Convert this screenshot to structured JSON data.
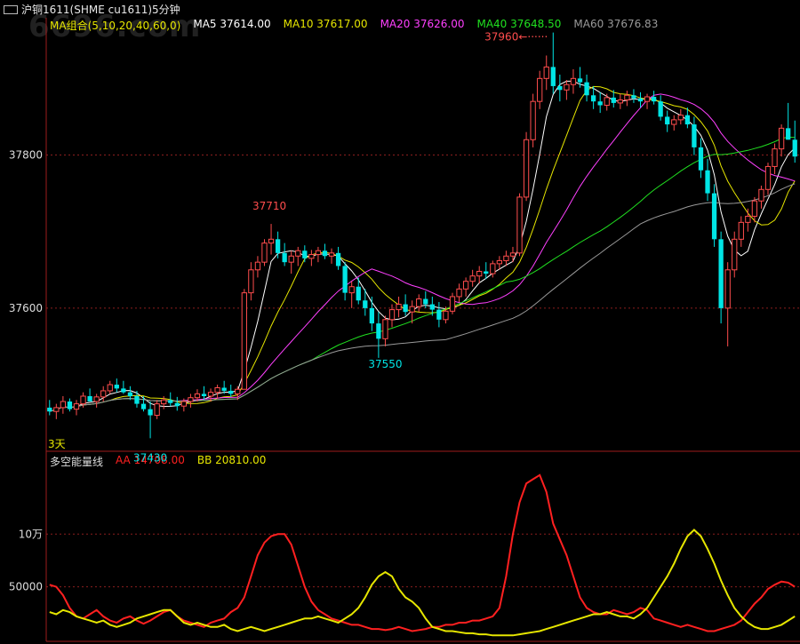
{
  "window": {
    "icon": "window-tab-icon",
    "title": "沪铜1611(SHME cu1611)5分钟",
    "watermark": "6696.com"
  },
  "colors": {
    "background": "#000000",
    "axis": "#9e1d1d",
    "grid": "#8b1e1e",
    "up_candle": "#ff4d4d",
    "down_candle": "#00e5e5",
    "ma5": "#ffffff",
    "ma10": "#e6e600",
    "ma20": "#ff40ff",
    "ma40": "#20e020",
    "ma60": "#999999",
    "aa": "#ff2020",
    "bb": "#e6e600"
  },
  "ma_legend": [
    {
      "label": "MA组合(5,10,20,40,60,0)",
      "color": "#e6e600"
    },
    {
      "label": "MA5",
      "value": "37614.00",
      "color": "#ffffff"
    },
    {
      "label": "MA10",
      "value": "37617.00",
      "color": "#e6e600"
    },
    {
      "label": "MA20",
      "value": "37626.00",
      "color": "#ff40ff"
    },
    {
      "label": "MA40",
      "value": "37648.50",
      "color": "#20e020"
    },
    {
      "label": "MA60",
      "value": "37676.83",
      "color": "#999999"
    }
  ],
  "indicator_legend": [
    {
      "label": "多空能量线",
      "color": "#dddddd"
    },
    {
      "label": "AA",
      "value": "14708.00",
      "color": "#ff2020"
    },
    {
      "label": "BB",
      "value": "20810.00",
      "color": "#e6e600"
    }
  ],
  "annotations": {
    "high_label": "37960",
    "local_high_label": "37710",
    "low_label": "37430",
    "local_low_label": "37550",
    "day_marker": "3天"
  },
  "chart_data": [
    {
      "type": "candlestick",
      "title": "沪铜1611(SHME cu1611)5分钟",
      "y_ticks": [
        37600,
        37800
      ],
      "y_range": [
        37420,
        37970
      ],
      "grid": true,
      "ohlc": [
        [
          37470,
          37480,
          37460,
          37465
        ],
        [
          37465,
          37475,
          37455,
          37470
        ],
        [
          37470,
          37485,
          37462,
          37478
        ],
        [
          37478,
          37482,
          37465,
          37468
        ],
        [
          37468,
          37480,
          37460,
          37475
        ],
        [
          37475,
          37490,
          37470,
          37485
        ],
        [
          37485,
          37495,
          37480,
          37478
        ],
        [
          37478,
          37488,
          37470,
          37484
        ],
        [
          37484,
          37498,
          37478,
          37492
        ],
        [
          37492,
          37505,
          37488,
          37500
        ],
        [
          37500,
          37508,
          37490,
          37495
        ],
        [
          37495,
          37505,
          37488,
          37490
        ],
        [
          37490,
          37498,
          37480,
          37485
        ],
        [
          37485,
          37492,
          37470,
          37475
        ],
        [
          37475,
          37485,
          37465,
          37468
        ],
        [
          37468,
          37478,
          37430,
          37460
        ],
        [
          37460,
          37480,
          37455,
          37475
        ],
        [
          37475,
          37485,
          37468,
          37480
        ],
        [
          37480,
          37490,
          37472,
          37476
        ],
        [
          37476,
          37484,
          37466,
          37472
        ],
        [
          37472,
          37482,
          37465,
          37478
        ],
        [
          37478,
          37488,
          37470,
          37483
        ],
        [
          37483,
          37494,
          37478,
          37488
        ],
        [
          37488,
          37498,
          37480,
          37485
        ],
        [
          37485,
          37495,
          37478,
          37490
        ],
        [
          37490,
          37500,
          37482,
          37496
        ],
        [
          37496,
          37505,
          37488,
          37492
        ],
        [
          37492,
          37500,
          37484,
          37488
        ],
        [
          37488,
          37498,
          37480,
          37494
        ],
        [
          37494,
          37625,
          37590,
          37620
        ],
        [
          37620,
          37660,
          37610,
          37650
        ],
        [
          37650,
          37668,
          37640,
          37660
        ],
        [
          37660,
          37690,
          37655,
          37685
        ],
        [
          37685,
          37710,
          37670,
          37690
        ],
        [
          37690,
          37700,
          37665,
          37672
        ],
        [
          37672,
          37685,
          37655,
          37660
        ],
        [
          37660,
          37675,
          37645,
          37668
        ],
        [
          37668,
          37680,
          37655,
          37675
        ],
        [
          37675,
          37682,
          37660,
          37665
        ],
        [
          37665,
          37676,
          37655,
          37670
        ],
        [
          37670,
          37680,
          37660,
          37675
        ],
        [
          37675,
          37684,
          37664,
          37668
        ],
        [
          37668,
          37678,
          37658,
          37672
        ],
        [
          37672,
          37680,
          37650,
          37655
        ],
        [
          37655,
          37660,
          37610,
          37620
        ],
        [
          37620,
          37635,
          37600,
          37628
        ],
        [
          37628,
          37640,
          37605,
          37610
        ],
        [
          37610,
          37625,
          37590,
          37600
        ],
        [
          37600,
          37615,
          37570,
          37580
        ],
        [
          37580,
          37595,
          37535,
          37560
        ],
        [
          37560,
          37590,
          37550,
          37585
        ],
        [
          37585,
          37605,
          37575,
          37598
        ],
        [
          37598,
          37615,
          37588,
          37605
        ],
        [
          37605,
          37618,
          37590,
          37595
        ],
        [
          37595,
          37610,
          37580,
          37602
        ],
        [
          37602,
          37618,
          37595,
          37612
        ],
        [
          37612,
          37622,
          37600,
          37605
        ],
        [
          37605,
          37615,
          37590,
          37598
        ],
        [
          37598,
          37608,
          37575,
          37585
        ],
        [
          37585,
          37602,
          37580,
          37596
        ],
        [
          37596,
          37620,
          37592,
          37615
        ],
        [
          37615,
          37632,
          37608,
          37625
        ],
        [
          37625,
          37640,
          37615,
          37635
        ],
        [
          37635,
          37650,
          37628,
          37642
        ],
        [
          37642,
          37655,
          37632,
          37648
        ],
        [
          37648,
          37660,
          37638,
          37645
        ],
        [
          37645,
          37662,
          37640,
          37658
        ],
        [
          37658,
          37668,
          37650,
          37662
        ],
        [
          37662,
          37675,
          37655,
          37668
        ],
        [
          37668,
          37680,
          37660,
          37672
        ],
        [
          37672,
          37750,
          37668,
          37745
        ],
        [
          37745,
          37830,
          37740,
          37820
        ],
        [
          37820,
          37880,
          37810,
          37870
        ],
        [
          37870,
          37910,
          37860,
          37900
        ],
        [
          37900,
          37930,
          37885,
          37915
        ],
        [
          37915,
          37960,
          37880,
          37890
        ],
        [
          37890,
          37905,
          37870,
          37885
        ],
        [
          37885,
          37898,
          37872,
          37892
        ],
        [
          37892,
          37912,
          37880,
          37900
        ],
        [
          37900,
          37915,
          37888,
          37895
        ],
        [
          37895,
          37905,
          37870,
          37878
        ],
        [
          37878,
          37890,
          37860,
          37870
        ],
        [
          37870,
          37882,
          37855,
          37865
        ],
        [
          37865,
          37880,
          37858,
          37875
        ],
        [
          37875,
          37885,
          37862,
          37868
        ],
        [
          37868,
          37880,
          37860,
          37872
        ],
        [
          37872,
          37884,
          37864,
          37878
        ],
        [
          37878,
          37886,
          37868,
          37874
        ],
        [
          37874,
          37882,
          37862,
          37870
        ],
        [
          37870,
          37880,
          37860,
          37876
        ],
        [
          37876,
          37884,
          37866,
          37870
        ],
        [
          37870,
          37878,
          37845,
          37850
        ],
        [
          37850,
          37858,
          37830,
          37840
        ],
        [
          37840,
          37852,
          37832,
          37846
        ],
        [
          37846,
          37860,
          37840,
          37852
        ],
        [
          37852,
          37862,
          37835,
          37840
        ],
        [
          37840,
          37850,
          37800,
          37810
        ],
        [
          37810,
          37822,
          37770,
          37780
        ],
        [
          37780,
          37795,
          37740,
          37750
        ],
        [
          37750,
          37762,
          37680,
          37690
        ],
        [
          37690,
          37700,
          37580,
          37600
        ],
        [
          37600,
          37660,
          37550,
          37650
        ],
        [
          37650,
          37700,
          37640,
          37690
        ],
        [
          37690,
          37720,
          37680,
          37712
        ],
        [
          37712,
          37730,
          37700,
          37720
        ],
        [
          37720,
          37745,
          37712,
          37740
        ],
        [
          37740,
          37760,
          37730,
          37755
        ],
        [
          37755,
          37790,
          37748,
          37785
        ],
        [
          37785,
          37815,
          37775,
          37808
        ],
        [
          37808,
          37840,
          37798,
          37835
        ],
        [
          37835,
          37868,
          37820,
          37820
        ],
        [
          37820,
          37845,
          37790,
          37798
        ]
      ],
      "series": [
        {
          "name": "MA5",
          "color": "#ffffff"
        },
        {
          "name": "MA10",
          "color": "#e6e600"
        },
        {
          "name": "MA20",
          "color": "#ff40ff"
        },
        {
          "name": "MA40",
          "color": "#20e020"
        },
        {
          "name": "MA60",
          "color": "#999999"
        }
      ]
    },
    {
      "type": "line",
      "title": "多空能量线",
      "y_ticks": [
        {
          "value": 50000,
          "label": "50000"
        },
        {
          "value": 100000,
          "label": "10万"
        }
      ],
      "y_range": [
        0,
        160000
      ],
      "grid": true,
      "series": [
        {
          "name": "AA",
          "color": "#ff2020",
          "values": [
            52000,
            50000,
            42000,
            30000,
            22000,
            20000,
            24000,
            28000,
            22000,
            18000,
            16000,
            20000,
            22000,
            18000,
            15000,
            18000,
            22000,
            26000,
            28000,
            22000,
            18000,
            16000,
            14000,
            12000,
            16000,
            18000,
            20000,
            26000,
            30000,
            40000,
            60000,
            80000,
            92000,
            98000,
            100000,
            100000,
            90000,
            70000,
            50000,
            36000,
            28000,
            24000,
            20000,
            18000,
            16000,
            14000,
            14000,
            12000,
            10000,
            10000,
            9000,
            10000,
            12000,
            10000,
            8000,
            9000,
            10000,
            12000,
            12000,
            14000,
            14000,
            16000,
            16000,
            18000,
            18000,
            20000,
            22000,
            30000,
            60000,
            100000,
            130000,
            148000,
            152000,
            156000,
            140000,
            110000,
            95000,
            80000,
            60000,
            40000,
            30000,
            26000,
            24000,
            24000,
            28000,
            26000,
            24000,
            26000,
            30000,
            28000,
            20000,
            18000,
            16000,
            14000,
            12000,
            14000,
            12000,
            10000,
            8000,
            8000,
            10000,
            12000,
            14000,
            18000,
            26000,
            34000,
            40000,
            48000,
            52000,
            55000,
            54000,
            50000
          ]
        },
        {
          "name": "BB",
          "color": "#e6e600",
          "values": [
            26000,
            24000,
            28000,
            26000,
            22000,
            20000,
            18000,
            16000,
            18000,
            14000,
            12000,
            14000,
            16000,
            20000,
            22000,
            24000,
            26000,
            28000,
            28000,
            22000,
            16000,
            14000,
            16000,
            14000,
            12000,
            12000,
            14000,
            10000,
            8000,
            10000,
            12000,
            10000,
            8000,
            10000,
            12000,
            14000,
            16000,
            18000,
            20000,
            20000,
            22000,
            20000,
            18000,
            16000,
            20000,
            24000,
            30000,
            40000,
            52000,
            60000,
            64000,
            60000,
            48000,
            40000,
            36000,
            30000,
            20000,
            12000,
            10000,
            8000,
            8000,
            7000,
            6000,
            6000,
            5000,
            5000,
            4000,
            4000,
            4000,
            4000,
            5000,
            6000,
            7000,
            8000,
            10000,
            12000,
            14000,
            16000,
            18000,
            20000,
            22000,
            24000,
            24000,
            26000,
            24000,
            22000,
            22000,
            20000,
            24000,
            30000,
            40000,
            50000,
            60000,
            72000,
            86000,
            98000,
            104000,
            98000,
            86000,
            72000,
            56000,
            42000,
            30000,
            22000,
            16000,
            12000,
            10000,
            10000,
            12000,
            14000,
            18000,
            22000
          ]
        }
      ]
    }
  ]
}
